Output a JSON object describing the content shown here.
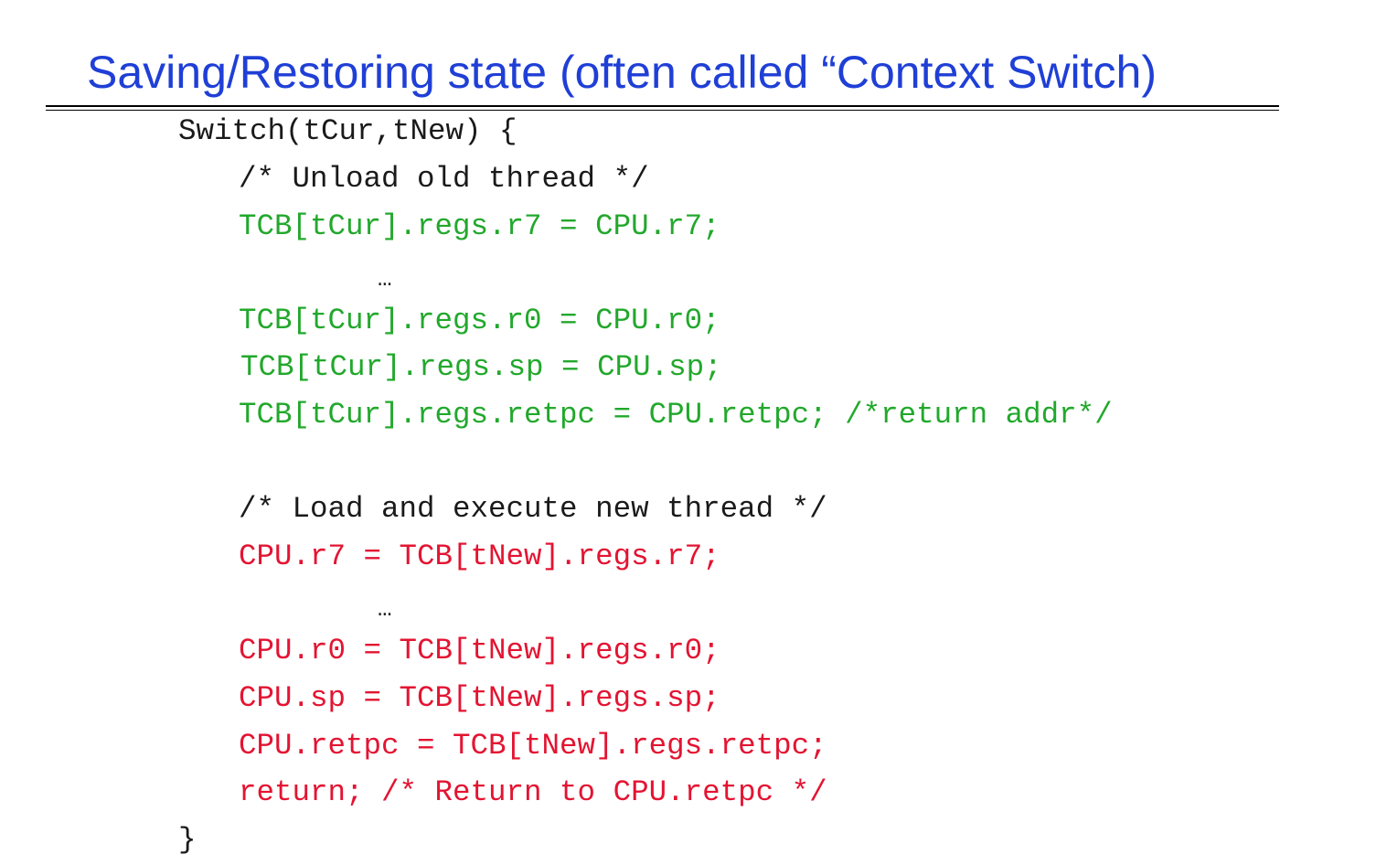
{
  "slide": {
    "title": "Saving/Restoring state (often called “Context Switch)"
  },
  "code": {
    "function_header": "Switch(tCur,tNew) {",
    "comment_unload": "/* Unload old thread */",
    "unload_lines": [
      "TCB[tCur].regs.r7 = CPU.r7;",
      "…",
      "TCB[tCur].regs.r0 = CPU.r0;",
      "TCB[tCur].regs.sp = CPU.sp;",
      "TCB[tCur].regs.retpc = CPU.retpc; /*return addr*/"
    ],
    "comment_load": "/* Load and execute new thread */",
    "load_lines": [
      "CPU.r7 = TCB[tNew].regs.r7;",
      "…",
      "CPU.r0 = TCB[tNew].regs.r0;",
      "CPU.sp = TCB[tNew].regs.sp;",
      "CPU.retpc = TCB[tNew].regs.retpc;",
      "return; /* Return to CPU.retpc */"
    ],
    "closing_brace": "}"
  },
  "colors": {
    "title": "#1f3fd6",
    "code_default": "#1a1a1a",
    "code_unload": "#22a82c",
    "code_load": "#e31432"
  }
}
